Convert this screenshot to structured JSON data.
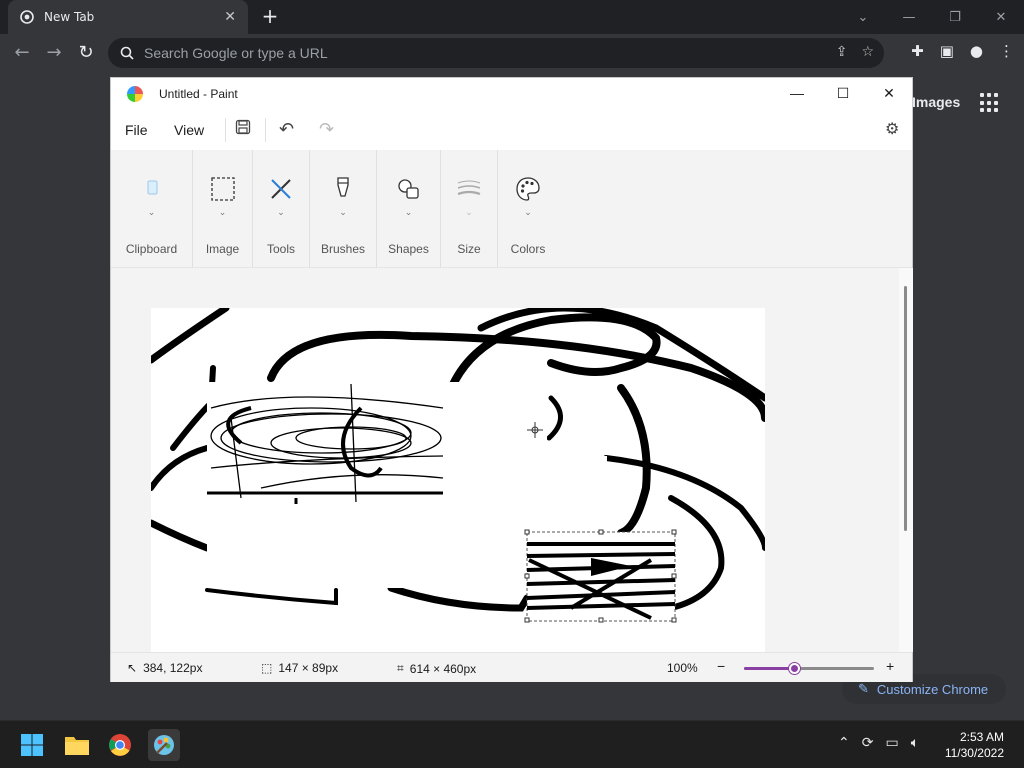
{
  "chrome": {
    "tab_title": "New Tab",
    "omnibox_placeholder": "Search Google or type a URL",
    "images_link": "Images",
    "customize_label": "Customize Chrome"
  },
  "paint": {
    "title": "Untitled - Paint",
    "menu": {
      "file": "File",
      "view": "View"
    },
    "ribbon_groups": [
      "Clipboard",
      "Image",
      "Tools",
      "Brushes",
      "Shapes",
      "Size",
      "Colors"
    ],
    "status": {
      "cursor_pos": "384, 122px",
      "selection_size": "147 × 89px",
      "canvas_size": "614 × 460px",
      "zoom": "100%",
      "zoom_percent": 100
    },
    "accent_color": "#8a3fa3"
  },
  "taskbar": {
    "time": "2:53 AM",
    "date": "11/30/2022"
  }
}
